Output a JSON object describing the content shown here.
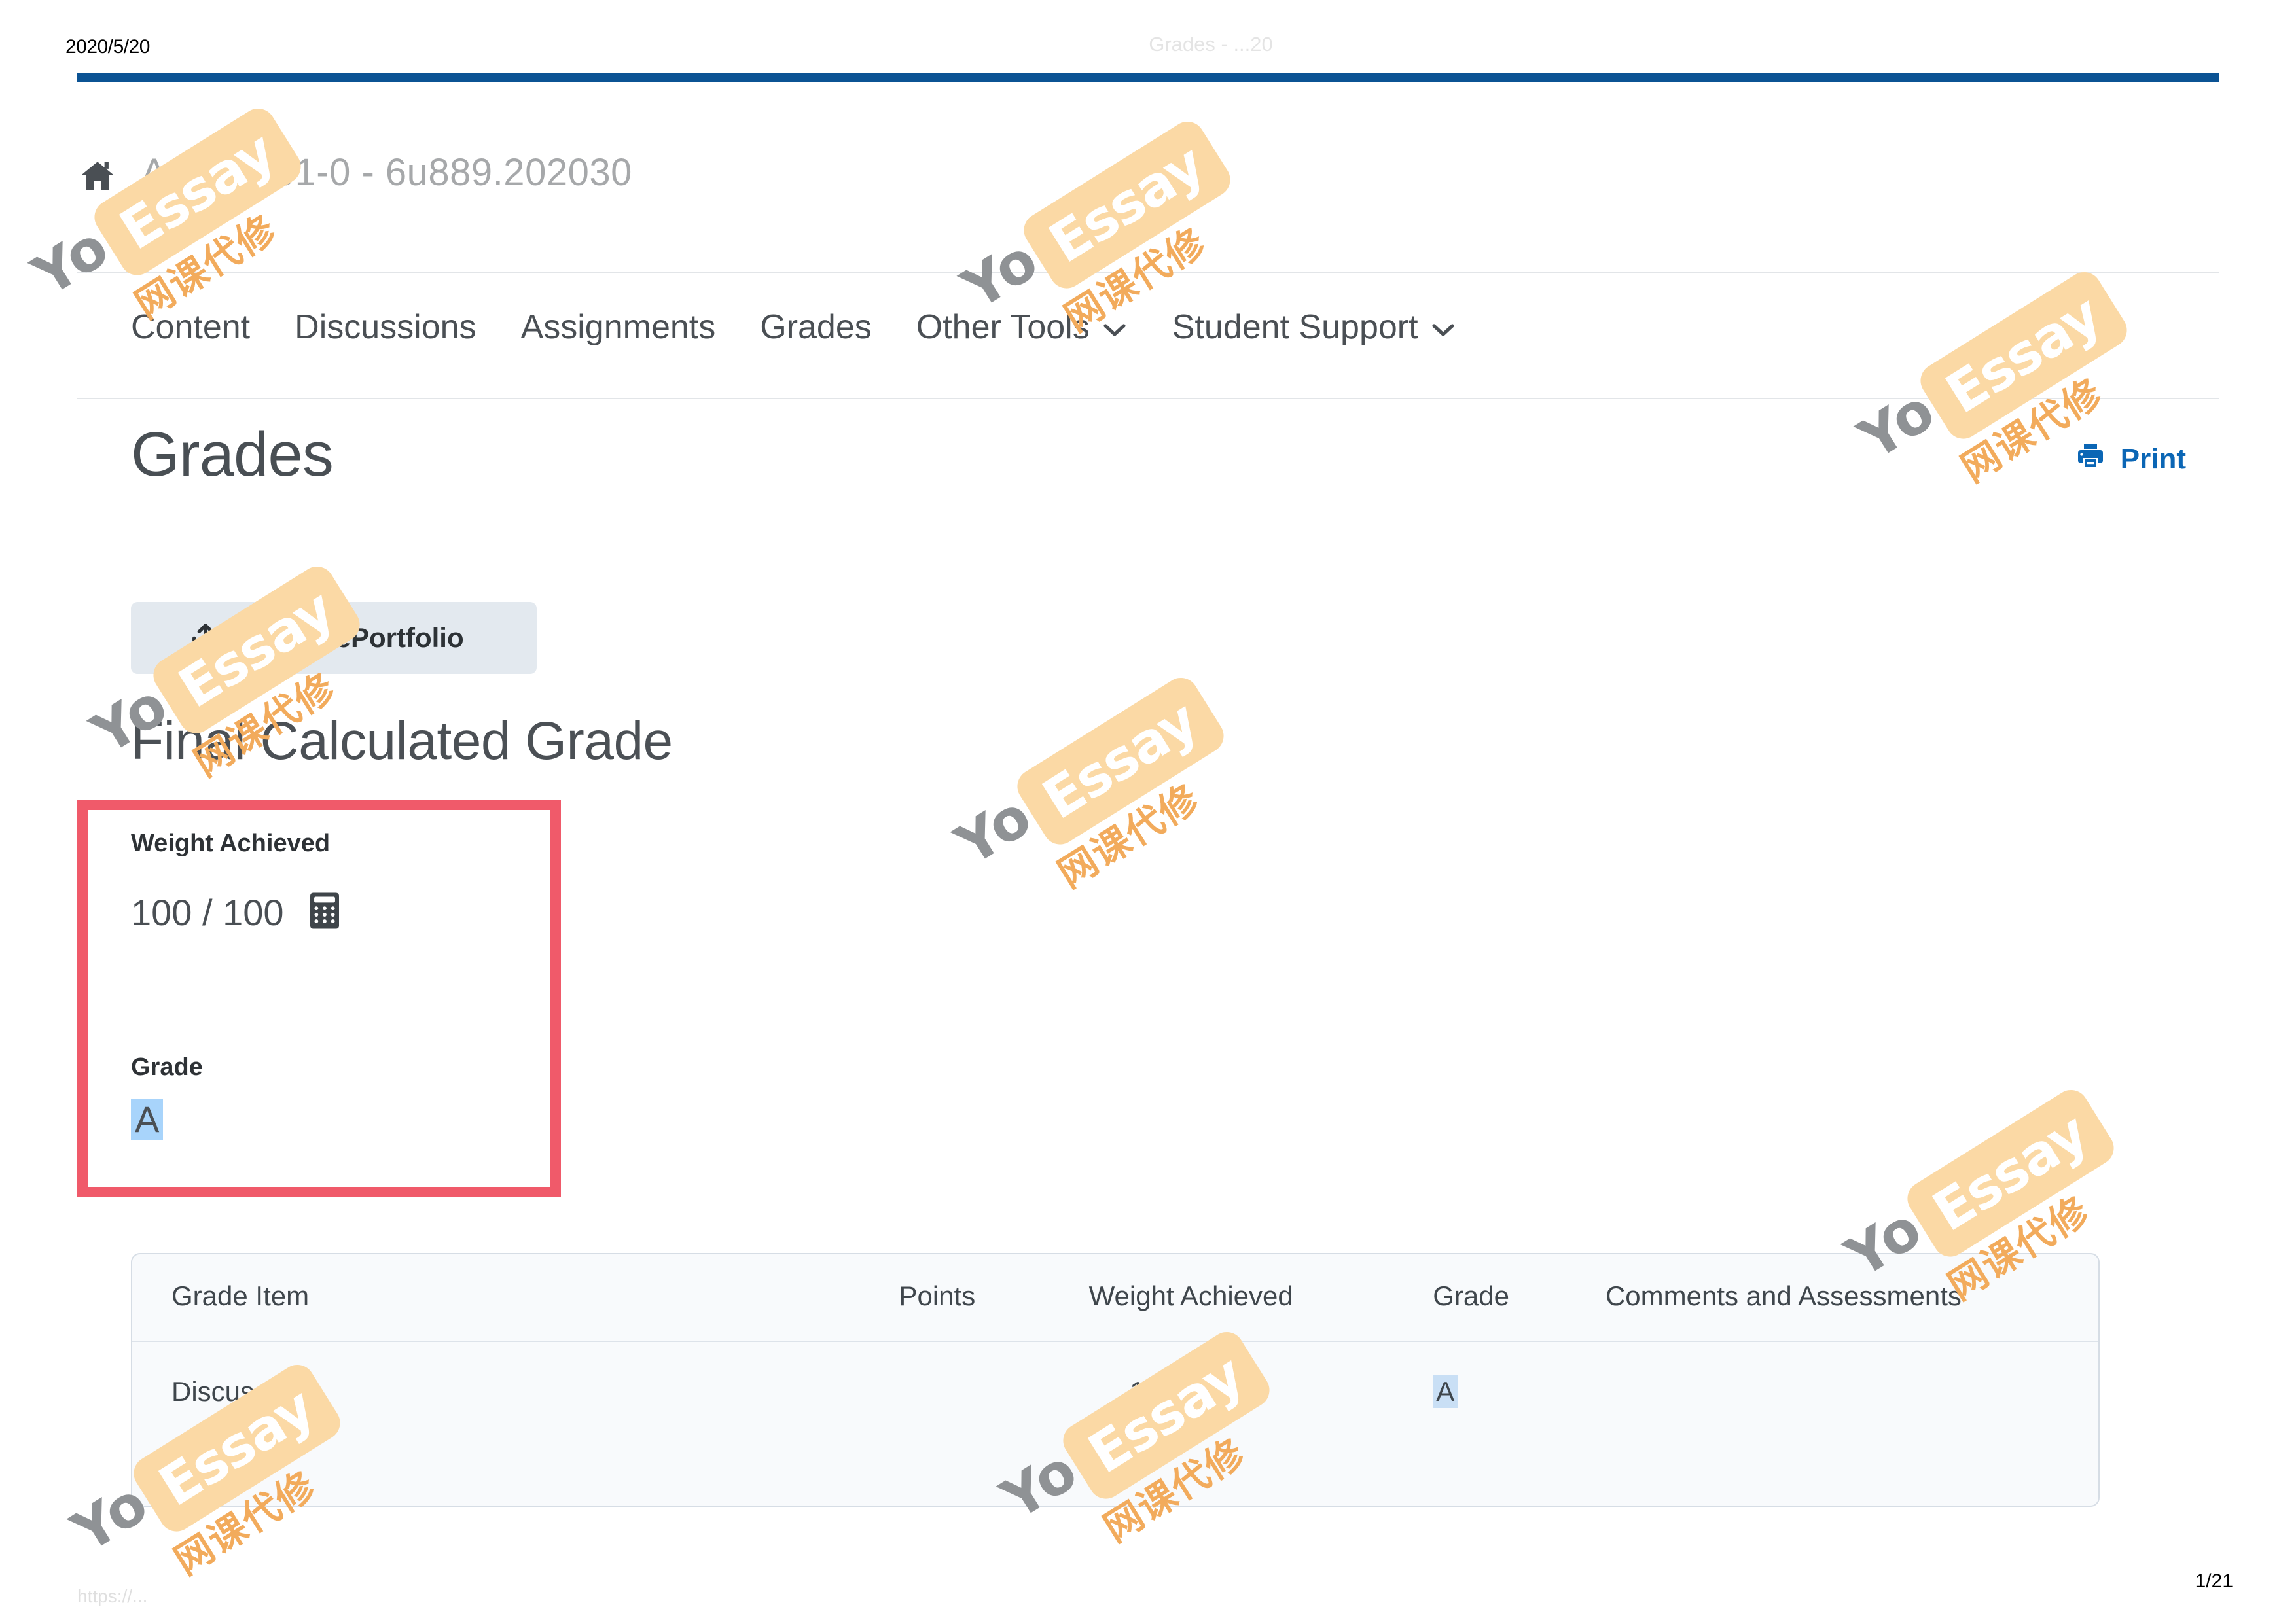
{
  "print_header": {
    "date": "2020/5/20",
    "center_title_faded": "Grades - ...20"
  },
  "print_footer": {
    "left_faded": "https://...",
    "page_indicator": "1/21"
  },
  "course": {
    "home_icon": "home-icon",
    "title": "ACH 1161-0 - 6u889.202030"
  },
  "nav": {
    "items": [
      {
        "label": "Content",
        "has_chevron": false
      },
      {
        "label": "Discussions",
        "has_chevron": false
      },
      {
        "label": "Assignments",
        "has_chevron": false
      },
      {
        "label": "Grades",
        "has_chevron": false
      },
      {
        "label": "Other Tools",
        "has_chevron": true
      },
      {
        "label": "Student Support",
        "has_chevron": true
      }
    ],
    "chevron_icon": "chevron-down-icon"
  },
  "page": {
    "title": "Grades"
  },
  "print_action": {
    "label": "Print",
    "icon": "printer-icon",
    "color": "#0b66b5"
  },
  "eportfolio": {
    "label": "Add to ePortfolio",
    "icon": "export-icon",
    "background": "#e3e9ef"
  },
  "final_grade": {
    "section_title": "Final Calculated Grade",
    "weight_label": "Weight Achieved",
    "weight_value": "100 / 100",
    "calculator_icon": "calculator-icon",
    "grade_label": "Grade",
    "grade_value": "A",
    "highlight_color": "#a8d4fb",
    "annotation_box_color": "#f05a6a"
  },
  "grade_table": {
    "headers": [
      "Grade Item",
      "Points",
      "Weight Achieved",
      "Grade",
      "Comments and Assessments"
    ],
    "rows": [
      {
        "item": "Discussions",
        "points": "",
        "weight": "18.33 / 20",
        "grade": "A",
        "comments": ""
      }
    ]
  },
  "watermark": {
    "word_gray": "Your",
    "word_white": "Essay",
    "word_cn": "网课代修",
    "chip_color": "#fbd9a5",
    "gray_color": "#8f9295",
    "cn_color": "#f2ab5c"
  }
}
